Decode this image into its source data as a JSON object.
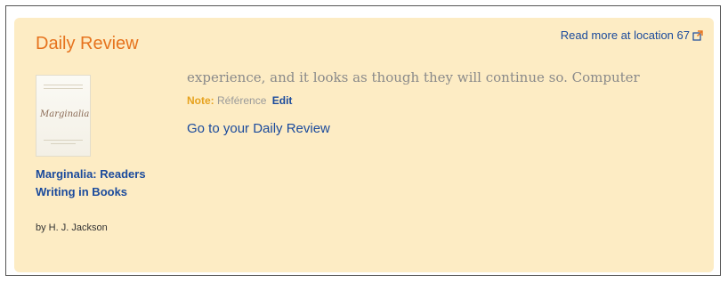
{
  "panel": {
    "title": "Daily Review",
    "read_more_label": "Read more at location 67"
  },
  "book": {
    "cover_script": "Marginalia",
    "title": "Marginalia: Readers Writing in Books",
    "author": "by H. J. Jackson"
  },
  "highlight": {
    "quote": "experience, and it looks as though they will continue so. Computer",
    "note_label": "Note:",
    "note_text": "Référence",
    "edit_label": "Edit"
  },
  "goto_label": "Go to your Daily Review",
  "colors": {
    "panel_bg": "#fdecc4",
    "title": "#e6731e",
    "link": "#1a4a9c",
    "note_label": "#e6a21e",
    "quote": "#8a8a8a"
  },
  "icons": {
    "external_link": "external-link-icon"
  }
}
